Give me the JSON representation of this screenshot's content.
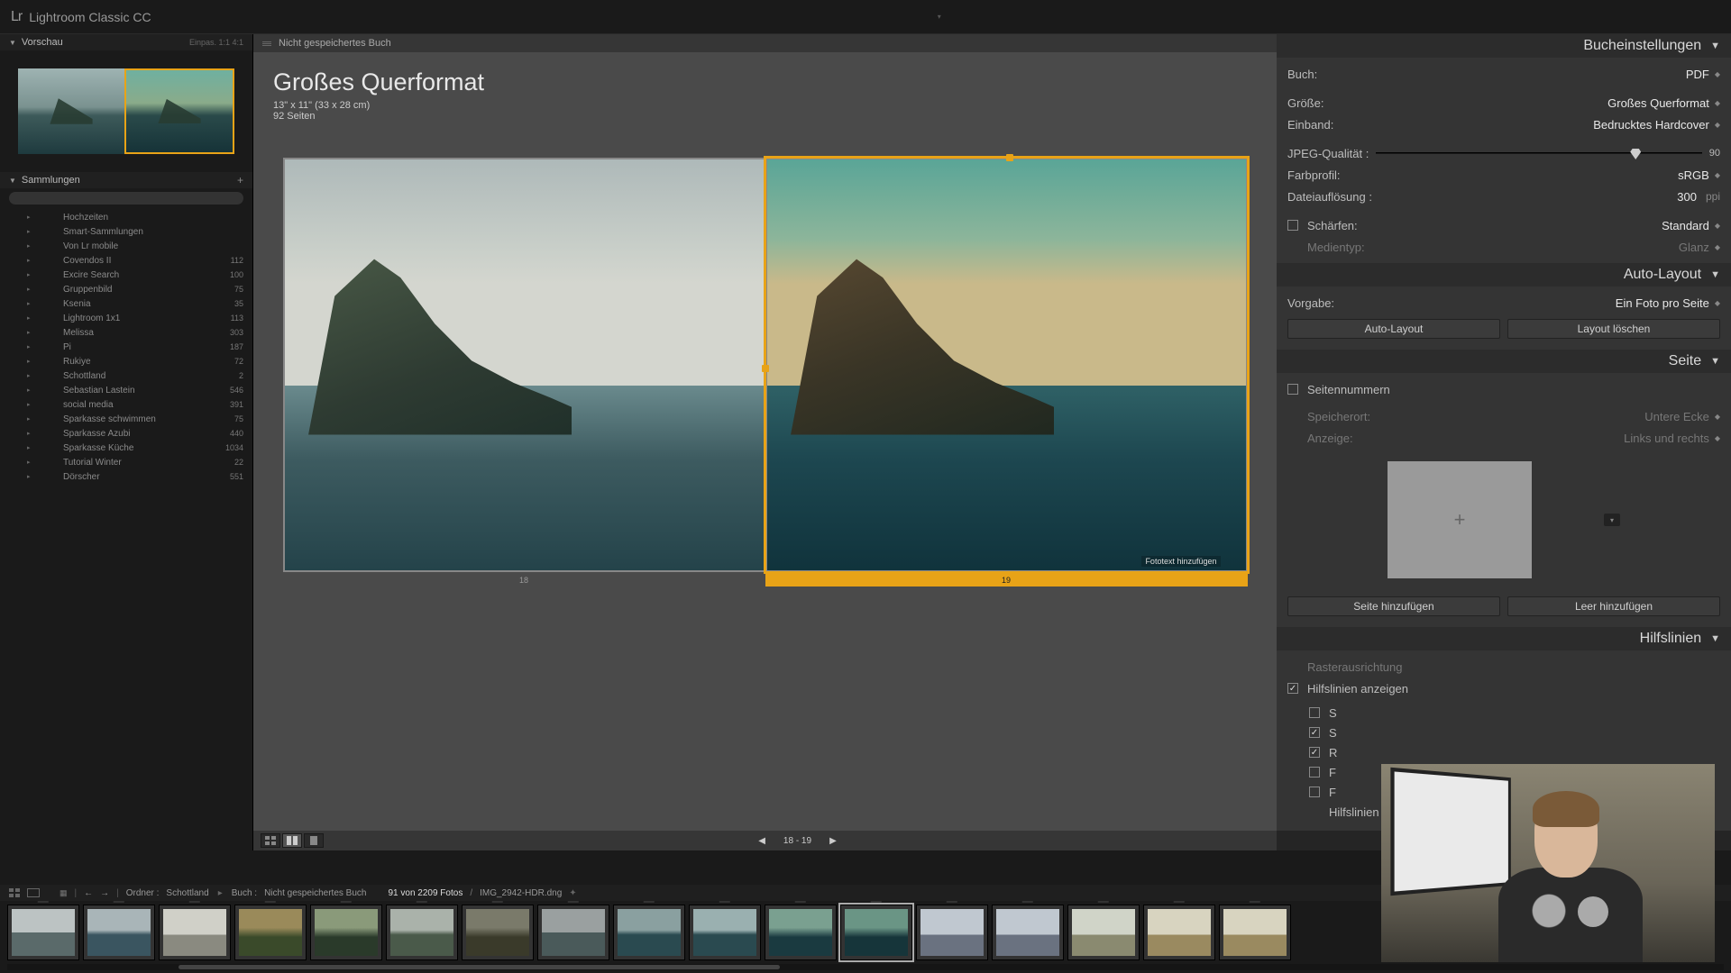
{
  "app": {
    "logo": "Lr",
    "title": "Lightroom Classic CC"
  },
  "left": {
    "preview": {
      "title": "Vorschau",
      "opts": "Einpas.   1:1   4:1"
    },
    "collections": {
      "title": "Sammlungen",
      "items": [
        {
          "name": "Hochzeiten",
          "count": ""
        },
        {
          "name": "Smart-Sammlungen",
          "count": ""
        },
        {
          "name": "Von Lr mobile",
          "count": ""
        },
        {
          "name": "Covendos II",
          "count": "112"
        },
        {
          "name": "Excire Search",
          "count": "100"
        },
        {
          "name": "Gruppenbild",
          "count": "75"
        },
        {
          "name": "Ksenia",
          "count": "35"
        },
        {
          "name": "Lightroom 1x1",
          "count": "113"
        },
        {
          "name": "Melissa",
          "count": "303"
        },
        {
          "name": "Pi",
          "count": "187"
        },
        {
          "name": "Rukiye",
          "count": "72"
        },
        {
          "name": "Schottland",
          "count": "2"
        },
        {
          "name": "Sebastian Lastein",
          "count": "546"
        },
        {
          "name": "social media",
          "count": "391"
        },
        {
          "name": "Sparkasse schwimmen",
          "count": "75"
        },
        {
          "name": "Sparkasse Azubi",
          "count": "440"
        },
        {
          "name": "Sparkasse Küche",
          "count": "1034"
        },
        {
          "name": "Tutorial Winter",
          "count": "22"
        },
        {
          "name": "Dörscher",
          "count": "551"
        }
      ]
    }
  },
  "center": {
    "doc_title": "Nicht gespeichertes Buch",
    "book_title": "Großes Querformat",
    "book_sub": "13\" x 11\" (33 x 28 cm)",
    "book_pages": "92 Seiten",
    "page_left": "18",
    "page_right": "19",
    "caption_hint": "Fototext hinzufügen",
    "nav_pages": "18  -  19"
  },
  "right": {
    "book_settings": {
      "title": "Bucheinstellungen",
      "rows": {
        "buch_l": "Buch:",
        "buch_v": "PDF",
        "groesse_l": "Größe:",
        "groesse_v": "Großes Querformat",
        "einband_l": "Einband:",
        "einband_v": "Bedrucktes Hardcover",
        "jpeg_l": "JPEG-Qualität :",
        "jpeg_v": "90",
        "farb_l": "Farbprofil:",
        "farb_v": "sRGB",
        "aufl_l": "Dateiauflösung :",
        "aufl_v": "300",
        "aufl_u": "ppi",
        "schaerfen_l": "Schärfen:",
        "schaerfen_v": "Standard",
        "medien_l": "Medientyp:",
        "medien_v": "Glanz"
      }
    },
    "auto_layout": {
      "title": "Auto-Layout",
      "vorgabe_l": "Vorgabe:",
      "vorgabe_v": "Ein Foto pro Seite",
      "btn_auto": "Auto-Layout",
      "btn_clear": "Layout löschen"
    },
    "seite": {
      "title": "Seite",
      "pagenum_l": "Seitennummern",
      "speicherort_l": "Speicherort:",
      "speicherort_v": "Untere Ecke",
      "anzeige_l": "Anzeige:",
      "anzeige_v": "Links und rechts",
      "btn_add": "Seite hinzufügen",
      "btn_blank": "Leer hinzufügen"
    },
    "hilfslinien": {
      "title": "Hilfslinien",
      "raster": "Rasterausrichtung",
      "show": "Hilfslinien anzeigen",
      "sub_s": "S",
      "sub_r": "R",
      "sub_f1": "F",
      "sub_f2": "F",
      "sub_hl": "Hilfslinien"
    }
  },
  "filmstrip": {
    "folder_l": "Ordner :",
    "folder_v": "Schottland",
    "book_l": "Buch :",
    "book_v": "Nicht gespeichertes Buch",
    "count": "91 von 2209 Fotos",
    "filename": "IMG_2942-HDR.dng",
    "badges": [
      "2",
      "2",
      "1",
      "2",
      "1",
      "1",
      "1",
      "1",
      "1",
      "1",
      "1",
      "1",
      "1",
      "1",
      "1",
      "1",
      "1"
    ]
  }
}
